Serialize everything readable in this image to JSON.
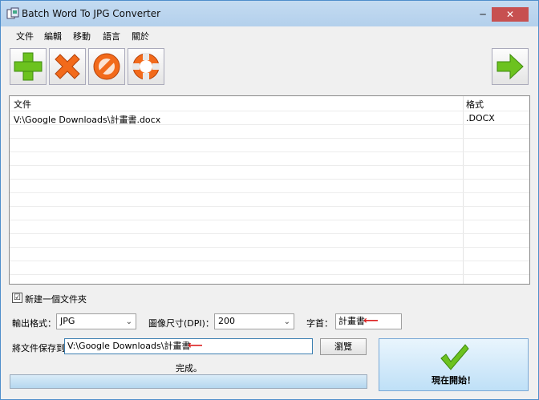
{
  "window": {
    "title": "Batch Word To JPG Converter",
    "minimize_glyph": "─",
    "close_glyph": "✕"
  },
  "menu": [
    "文件",
    "編輯",
    "移動",
    "語言",
    "關於"
  ],
  "toolbar": {
    "icons": [
      "add-icon",
      "remove-icon",
      "clear-icon",
      "help-icon",
      "next-arrow-icon"
    ],
    "colors": {
      "green": "#6cc21f",
      "orange": "#f26a1b",
      "grey": "#9aa0a6"
    }
  },
  "file_list": {
    "columns": [
      "文件",
      "格式"
    ],
    "rows": [
      {
        "file": "V:\\Google Downloads\\計畫書.docx",
        "format": ".DOCX"
      }
    ]
  },
  "options": {
    "new_folder_check": "☑",
    "new_folder_label": "新建一個文件夾",
    "format_label": "輸出格式：",
    "format_value": "JPG",
    "dpi_label": "圖像尺寸(DPI)：",
    "dpi_value": "200",
    "prefix_label": "字首：",
    "prefix_value": "計畫書",
    "arrow": "⟵"
  },
  "save": {
    "label": "將文件保存到",
    "path": "V:\\Google Downloads\\計畫書",
    "browse_label": "瀏覽"
  },
  "start_button": {
    "label": "現在開始！"
  },
  "status": {
    "text": "完成。",
    "progress": 1.0
  }
}
